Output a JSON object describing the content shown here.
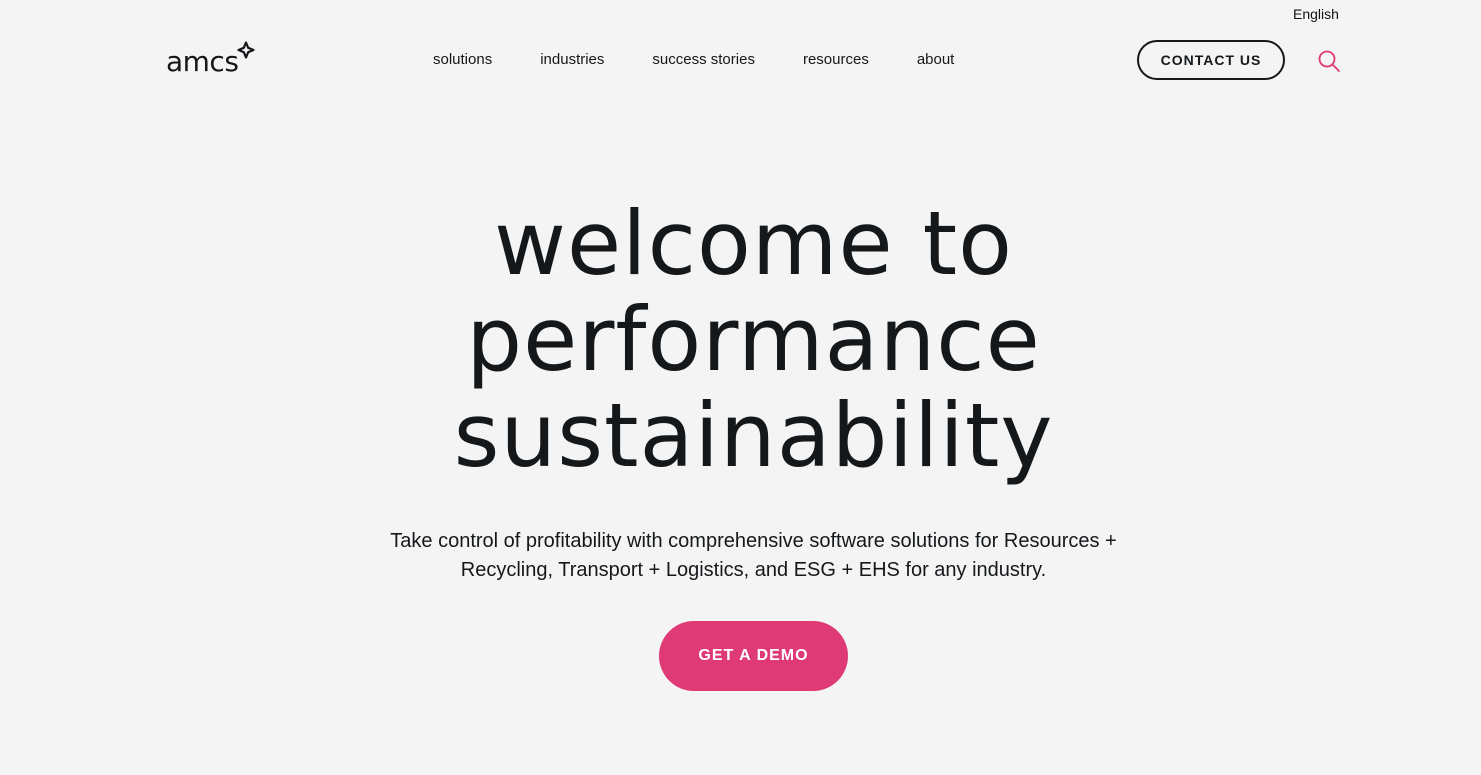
{
  "language": "English",
  "brand": {
    "logo_text": "amcs",
    "accent_color": "#e03a76",
    "text_color": "#15181b",
    "background_color": "#f4f4f4"
  },
  "nav": {
    "items": [
      {
        "label": "solutions"
      },
      {
        "label": "industries"
      },
      {
        "label": "success stories"
      },
      {
        "label": "resources"
      },
      {
        "label": "about"
      }
    ]
  },
  "header": {
    "contact_label": "CONTACT US",
    "search_icon": "search-icon"
  },
  "hero": {
    "title_lines": [
      "welcome to",
      "performance",
      "sustainability"
    ],
    "subtitle": "Take control of profitability with comprehensive software solutions for Resources + Recycling, Transport + Logistics, and ESG + EHS for any industry.",
    "cta_label": "GET A DEMO"
  }
}
